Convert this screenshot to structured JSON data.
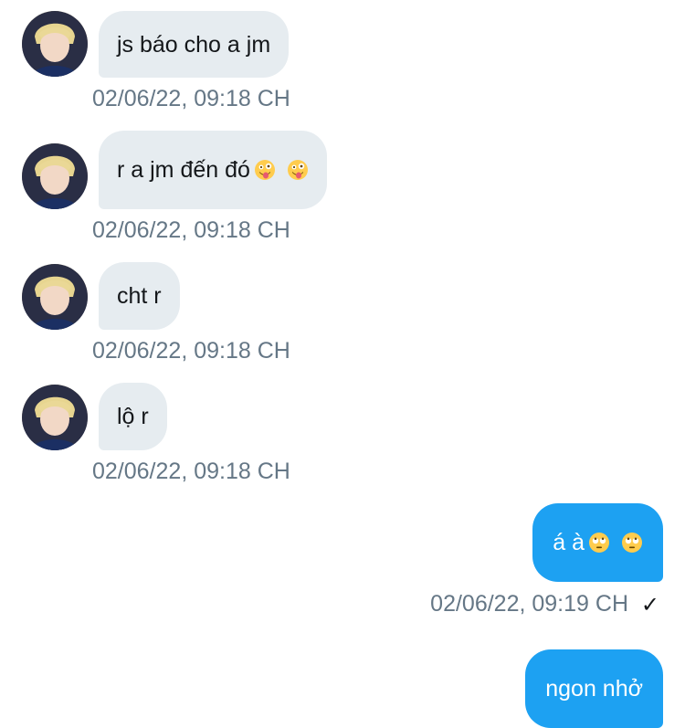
{
  "messages": [
    {
      "direction": "incoming",
      "text": "js báo cho a jm",
      "timestamp": "02/06/22, 09:18 CH",
      "avatar": "user-avatar"
    },
    {
      "direction": "incoming",
      "text": "r a jm đến đó",
      "emoji": [
        "zany-face",
        "zany-face"
      ],
      "timestamp": "02/06/22, 09:18 CH",
      "avatar": "user-avatar"
    },
    {
      "direction": "incoming",
      "text": "cht r",
      "timestamp": "02/06/22, 09:18 CH",
      "avatar": "user-avatar"
    },
    {
      "direction": "incoming",
      "text": "lộ r",
      "timestamp": "02/06/22, 09:18 CH",
      "avatar": "user-avatar"
    },
    {
      "direction": "outgoing",
      "text": "á à",
      "emoji": [
        "eye-roll-face",
        "eye-roll-face"
      ],
      "timestamp": "02/06/22, 09:19 CH",
      "status_icon": "check-icon"
    },
    {
      "direction": "outgoing",
      "text": "ngon nhở"
    }
  ],
  "colors": {
    "incoming_bubble": "#e6ecf0",
    "outgoing_bubble": "#1da1f2",
    "timestamp": "#657786"
  }
}
